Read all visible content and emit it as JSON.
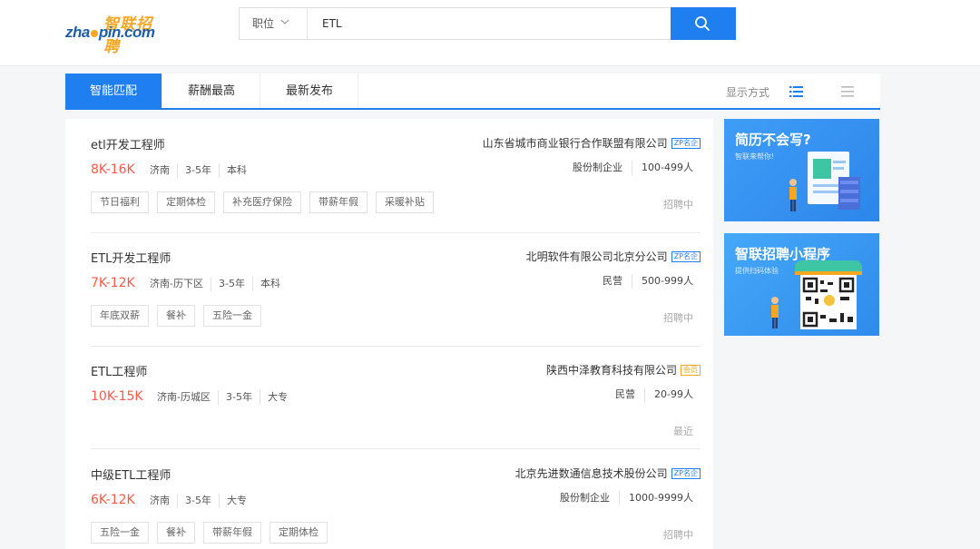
{
  "header": {
    "logo_cn": "智联招聘",
    "logo_en_left": "zha",
    "logo_en_right": "pin.com",
    "search_type": "职位",
    "search_value": "ETL"
  },
  "tabs": [
    "智能匹配",
    "薪酬最高",
    "最新发布"
  ],
  "display_label": "显示方式",
  "jobs": [
    {
      "title": "etl开发工程师",
      "salary": "8K-16K",
      "meta": [
        "济南",
        "3-5年",
        "本科"
      ],
      "tags": [
        "节日福利",
        "定期体检",
        "补充医疗保险",
        "带薪年假",
        "采暖补贴"
      ],
      "company": "山东省城市商业银行合作联盟有限公司",
      "badge": "ZP名企",
      "company_type": "股份制企业",
      "company_size": "100-499人",
      "status": "招聘中"
    },
    {
      "title": "ETL开发工程师",
      "salary": "7K-12K",
      "meta": [
        "济南-历下区",
        "3-5年",
        "本科"
      ],
      "tags": [
        "年底双薪",
        "餐补",
        "五险一金"
      ],
      "company": "北明软件有限公司北京分公司",
      "badge": "ZP名企",
      "company_type": "民营",
      "company_size": "500-999人",
      "status": "招聘中"
    },
    {
      "title": "ETL工程师",
      "salary": "10K-15K",
      "meta": [
        "济南-历城区",
        "3-5年",
        "大专"
      ],
      "tags": [],
      "company": "陕西中泽教育科技有限公司",
      "badge": "会员",
      "company_type": "民营",
      "company_size": "20-99人",
      "status": "最近"
    },
    {
      "title": "中级ETL工程师",
      "salary": "6K-12K",
      "meta": [
        "济南",
        "3-5年",
        "大专"
      ],
      "tags": [
        "五险一金",
        "餐补",
        "带薪年假",
        "定期体检"
      ],
      "company": "北京先进数通信息技术股份公司",
      "badge": "ZP名企",
      "company_type": "股份制企业",
      "company_size": "1000-9999人",
      "status": "招聘中"
    }
  ],
  "ads": [
    {
      "title": "简历不会写?",
      "subtitle": "智联来帮你!"
    },
    {
      "title": "智联招聘小程序",
      "subtitle": "提供扫码体验"
    }
  ],
  "colors": {
    "accent": "#1f7ef0",
    "salary": "#fa5a45",
    "member_badge": "#f5a623"
  }
}
